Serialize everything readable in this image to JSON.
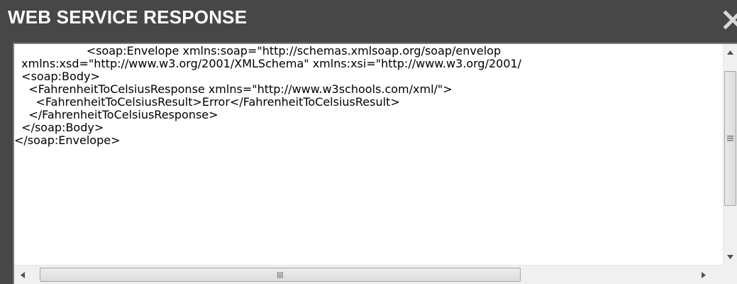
{
  "dialog": {
    "title": "WEB SERVICE RESPONSE",
    "close_icon": "close-x-icon"
  },
  "response": {
    "lines": [
      "                    <soap:Envelope xmlns:soap=\"http://schemas.xmlsoap.org/soap/envelop",
      "  xmlns:xsd=\"http://www.w3.org/2001/XMLSchema\" xmlns:xsi=\"http://www.w3.org/2001/",
      "  <soap:Body>",
      "    <FahrenheitToCelsiusResponse xmlns=\"http://www.w3schools.com/xml/\">",
      "      <FahrenheitToCelsiusResult>Error</FahrenheitToCelsiusResult>",
      "    </FahrenheitToCelsiusResponse>",
      "  </soap:Body>",
      "</soap:Envelope>"
    ]
  },
  "scrollbars": {
    "vertical_icons": [
      "scroll-up-arrow-icon",
      "scroll-grip-icon",
      "scroll-down-arrow-icon"
    ],
    "horizontal_icons": [
      "scroll-left-arrow-icon",
      "scroll-grip-icon",
      "scroll-right-arrow-icon"
    ]
  }
}
